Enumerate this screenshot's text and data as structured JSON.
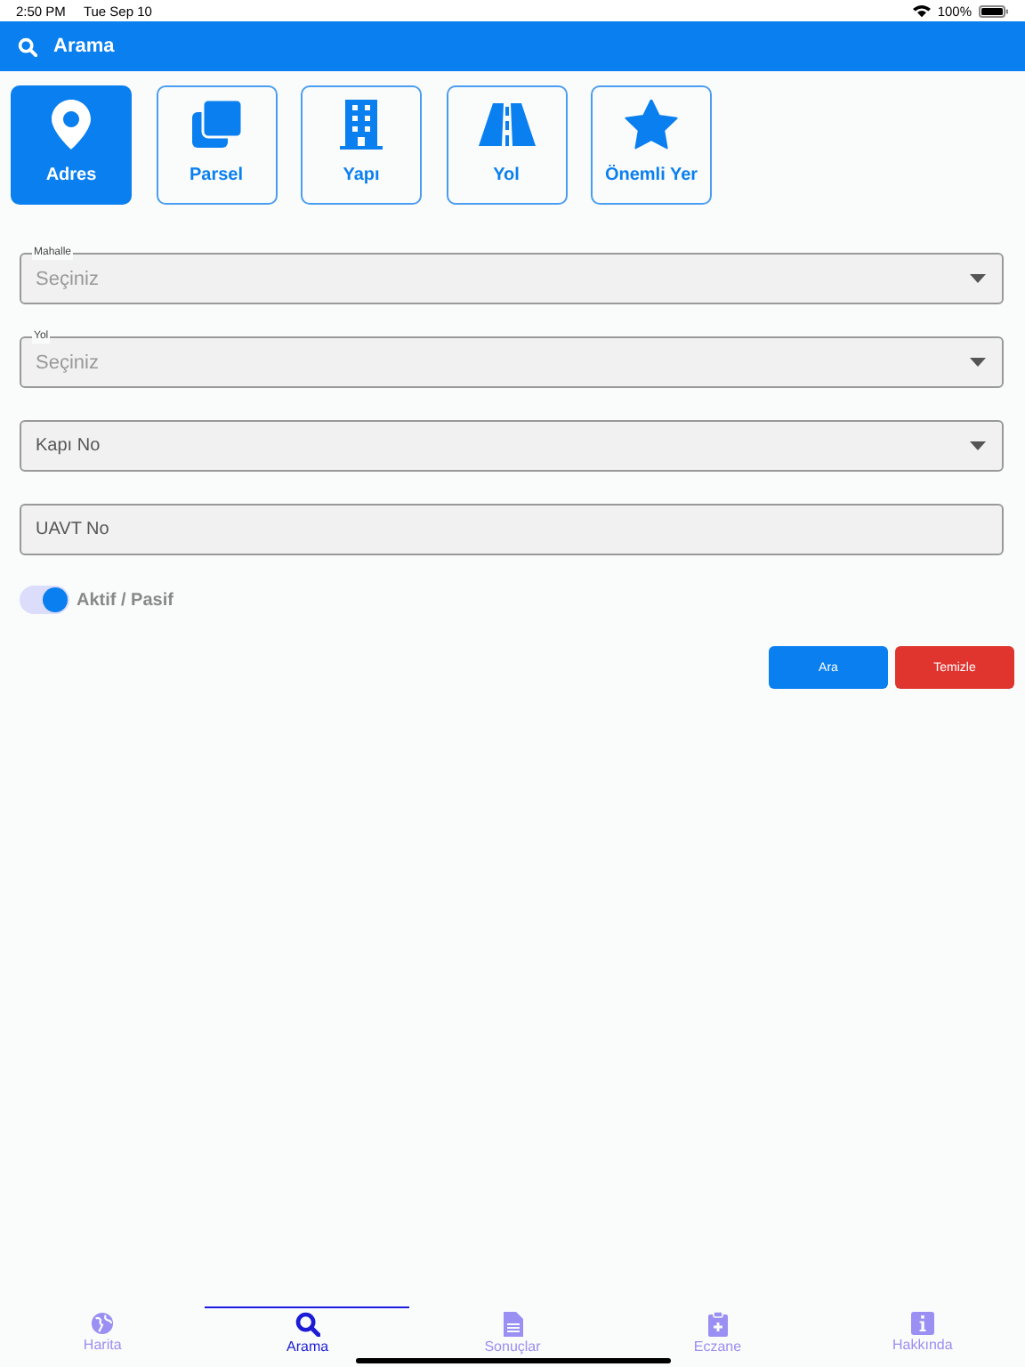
{
  "status_bar": {
    "time": "2:50 PM",
    "date": "Tue Sep 10",
    "battery": "100%"
  },
  "header": {
    "title": "Arama"
  },
  "categories": [
    {
      "label": "Adres",
      "selected": true
    },
    {
      "label": "Parsel",
      "selected": false
    },
    {
      "label": "Yapı",
      "selected": false
    },
    {
      "label": "Yol",
      "selected": false
    },
    {
      "label": "Önemli Yer",
      "selected": false
    }
  ],
  "fields": [
    {
      "kind": "select",
      "label": "Mahalle",
      "placeholder": "Seçiniz"
    },
    {
      "kind": "select",
      "label": "Yol",
      "placeholder": "Seçiniz"
    },
    {
      "kind": "select",
      "placeholder": "Kapı No"
    },
    {
      "kind": "text",
      "placeholder": "UAVT No"
    }
  ],
  "toggle": {
    "label": "Aktif / Pasif",
    "on": true
  },
  "buttons": [
    {
      "label": "Ara",
      "kind": "primary"
    },
    {
      "label": "Temizle",
      "kind": "danger"
    }
  ],
  "tabs": [
    {
      "label": "Harita",
      "selected": false
    },
    {
      "label": "Arama",
      "selected": true
    },
    {
      "label": "Sonuçlar",
      "selected": false
    },
    {
      "label": "Eczane",
      "selected": false
    },
    {
      "label": "Hakkında",
      "selected": false
    }
  ]
}
